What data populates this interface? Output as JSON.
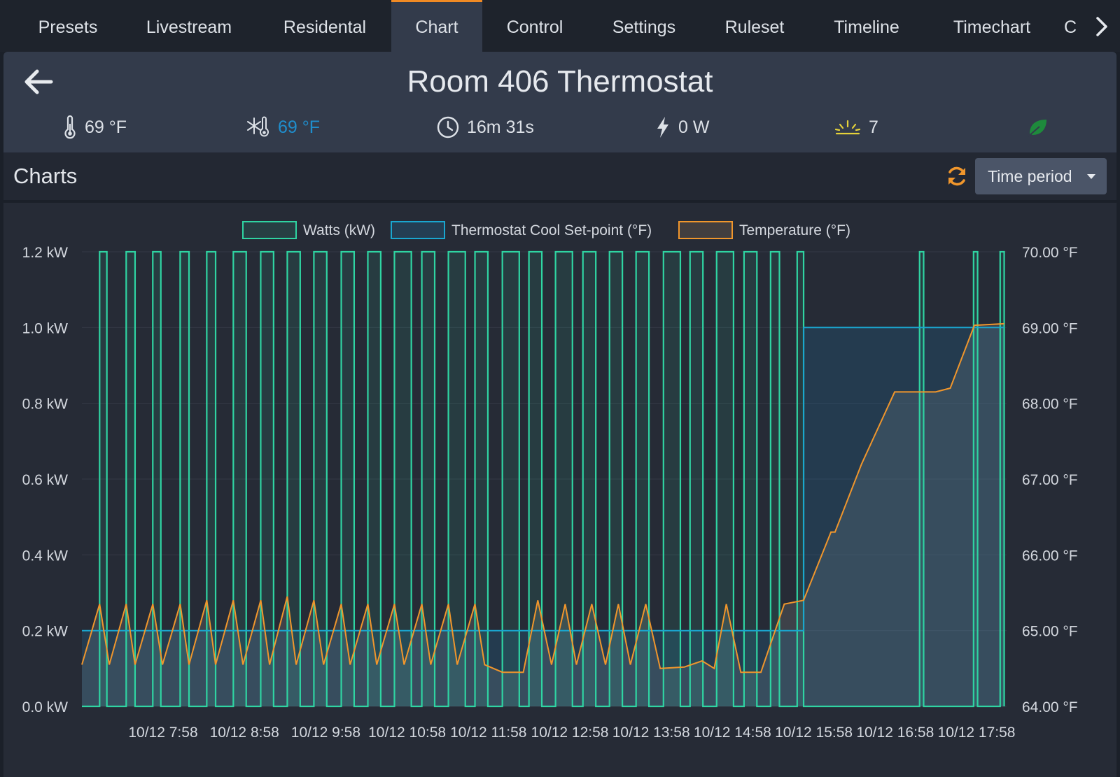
{
  "tabs": [
    {
      "label": "Presets",
      "active": false
    },
    {
      "label": "Livestream",
      "active": false
    },
    {
      "label": "Residental",
      "active": false
    },
    {
      "label": "Chart",
      "active": true
    },
    {
      "label": "Control",
      "active": false
    },
    {
      "label": "Settings",
      "active": false
    },
    {
      "label": "Ruleset",
      "active": false
    },
    {
      "label": "Timeline",
      "active": false
    },
    {
      "label": "Timechart",
      "active": false
    },
    {
      "label": "C",
      "active": false
    }
  ],
  "header": {
    "title": "Room 406 Thermostat",
    "stats": {
      "temperature": "69 °F",
      "cool_setpoint": "69 °F",
      "elapsed": "16m 31s",
      "power": "0 W",
      "sun_value": "7"
    },
    "icons": [
      "back-arrow-icon",
      "thermometer-icon",
      "snowflake-thermometer-icon",
      "clock-icon",
      "bolt-icon",
      "sunrise-icon",
      "leaf-icon"
    ]
  },
  "charts_section": {
    "title": "Charts",
    "time_period_label": "Time period"
  },
  "colors": {
    "watts": "#2fd4a2",
    "setpoint": "#1aa6cf",
    "temperature": "#f0962c",
    "accent": "#f08a24",
    "active_tab_border": "#f08a24"
  },
  "chart_data": {
    "type": "line",
    "legend": [
      "Watts (kW)",
      "Thermostat Cool Set-point (°F)",
      "Temperature (°F)"
    ],
    "legend_position": "top-center",
    "x_tick_labels": [
      "10/12 7:58",
      "10/12 8:58",
      "10/12 9:58",
      "10/12 10:58",
      "10/12 11:58",
      "10/12 12:58",
      "10/12 13:58",
      "10/12 14:58",
      "10/12 15:58",
      "10/12 16:58",
      "10/12 17:58"
    ],
    "x_hours_range": [
      7.0,
      18.48
    ],
    "y_left": {
      "ticks": [
        "0.0 kW",
        "0.2 kW",
        "0.4 kW",
        "0.6 kW",
        "0.8 kW",
        "1.0 kW",
        "1.2 kW"
      ],
      "min": 0,
      "max": 1.2
    },
    "y_right": {
      "ticks": [
        "64.00 °F",
        "65.00 °F",
        "66.00 °F",
        "67.00 °F",
        "68.00 °F",
        "69.00 °F",
        "70.00 °F"
      ],
      "min": 64,
      "max": 70
    },
    "grid": true,
    "series": [
      {
        "name": "Watts (kW)",
        "axis": "left",
        "on_intervals": [
          [
            7.22,
            7.31
          ],
          [
            7.55,
            7.66
          ],
          [
            7.88,
            7.98
          ],
          [
            8.22,
            8.33
          ],
          [
            8.55,
            8.66
          ],
          [
            8.88,
            9.04
          ],
          [
            9.22,
            9.38
          ],
          [
            9.55,
            9.71
          ],
          [
            9.88,
            10.04
          ],
          [
            10.22,
            10.38
          ],
          [
            10.55,
            10.71
          ],
          [
            10.88,
            11.09
          ],
          [
            11.22,
            11.38
          ],
          [
            11.55,
            11.76
          ],
          [
            11.88,
            12.04
          ],
          [
            12.22,
            12.43
          ],
          [
            12.55,
            12.71
          ],
          [
            12.88,
            13.09
          ],
          [
            13.22,
            13.38
          ],
          [
            13.55,
            13.71
          ],
          [
            13.88,
            14.04
          ],
          [
            14.22,
            14.43
          ],
          [
            14.55,
            14.71
          ],
          [
            14.88,
            15.09
          ],
          [
            15.22,
            15.38
          ],
          [
            15.55,
            15.66
          ],
          [
            15.88,
            15.96
          ],
          [
            17.4,
            17.45
          ],
          [
            18.07,
            18.12
          ],
          [
            18.4,
            18.45
          ]
        ],
        "on_value": 1.2,
        "off_value": 0
      },
      {
        "name": "Thermostat Cool Set-point (°F)",
        "axis": "right",
        "points": [
          [
            7.0,
            65.0
          ],
          [
            15.96,
            65.0
          ],
          [
            15.96,
            69.0
          ],
          [
            18.45,
            69.0
          ]
        ]
      },
      {
        "name": "Temperature (°F)",
        "axis": "right",
        "points": [
          [
            7.0,
            64.55
          ],
          [
            7.22,
            65.35
          ],
          [
            7.34,
            64.55
          ],
          [
            7.55,
            65.35
          ],
          [
            7.66,
            64.55
          ],
          [
            7.88,
            65.35
          ],
          [
            8.0,
            64.55
          ],
          [
            8.22,
            65.35
          ],
          [
            8.33,
            64.55
          ],
          [
            8.55,
            65.4
          ],
          [
            8.66,
            64.55
          ],
          [
            8.88,
            65.4
          ],
          [
            9.0,
            64.55
          ],
          [
            9.22,
            65.4
          ],
          [
            9.33,
            64.55
          ],
          [
            9.55,
            65.45
          ],
          [
            9.66,
            64.55
          ],
          [
            9.88,
            65.4
          ],
          [
            10.0,
            64.55
          ],
          [
            10.22,
            65.35
          ],
          [
            10.33,
            64.55
          ],
          [
            10.55,
            65.35
          ],
          [
            10.66,
            64.55
          ],
          [
            10.88,
            65.35
          ],
          [
            11.0,
            64.55
          ],
          [
            11.22,
            65.35
          ],
          [
            11.33,
            64.55
          ],
          [
            11.55,
            65.35
          ],
          [
            11.66,
            64.55
          ],
          [
            11.88,
            65.35
          ],
          [
            12.0,
            64.55
          ],
          [
            12.22,
            64.45
          ],
          [
            12.48,
            64.45
          ],
          [
            12.66,
            65.4
          ],
          [
            12.83,
            64.55
          ],
          [
            13.0,
            65.35
          ],
          [
            13.14,
            64.55
          ],
          [
            13.33,
            65.35
          ],
          [
            13.5,
            64.55
          ],
          [
            13.66,
            65.35
          ],
          [
            13.81,
            64.55
          ],
          [
            14.0,
            65.35
          ],
          [
            14.18,
            64.5
          ],
          [
            14.48,
            64.52
          ],
          [
            14.7,
            64.6
          ],
          [
            14.85,
            64.5
          ],
          [
            15.0,
            65.35
          ],
          [
            15.18,
            64.45
          ],
          [
            15.43,
            64.45
          ],
          [
            15.72,
            65.35
          ],
          [
            15.96,
            65.4
          ],
          [
            16.3,
            66.3
          ],
          [
            16.35,
            66.3
          ],
          [
            16.68,
            67.2
          ],
          [
            17.09,
            68.15
          ],
          [
            17.6,
            68.15
          ],
          [
            17.78,
            68.2
          ],
          [
            18.08,
            69.03
          ],
          [
            18.45,
            69.05
          ]
        ]
      }
    ]
  }
}
